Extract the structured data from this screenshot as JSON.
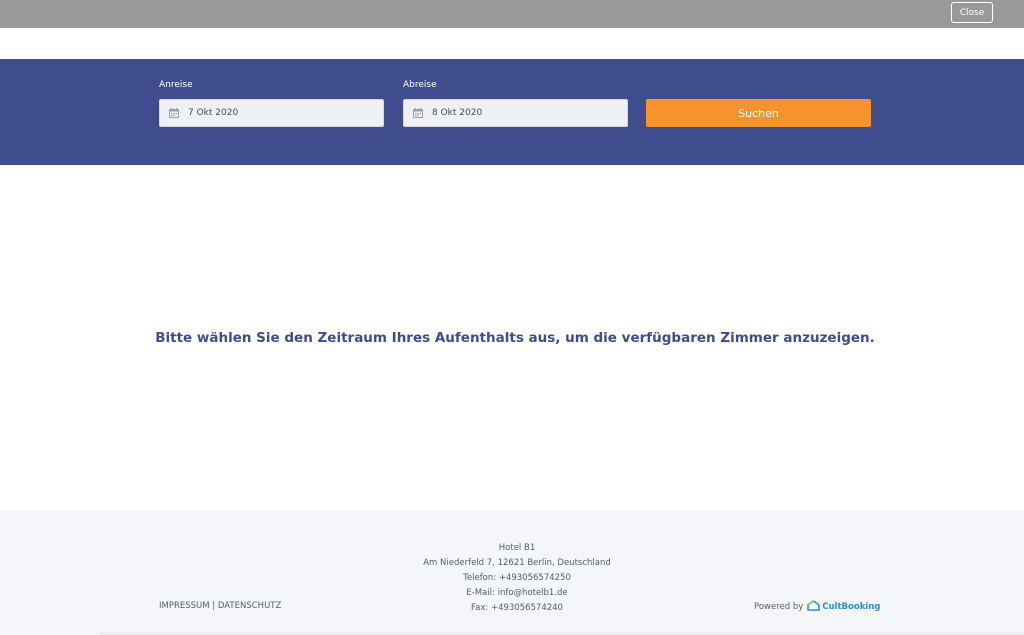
{
  "topbar": {
    "close_label": "Close"
  },
  "search": {
    "arrival_label": "Anreise",
    "arrival_value": "7 Okt 2020",
    "departure_label": "Abreise",
    "departure_value": "8 Okt 2020",
    "search_label": "Suchen",
    "calendar_icon": "calendar-icon"
  },
  "main": {
    "message": "Bitte wählen Sie den Zeitraum Ihres Aufenthalts aus, um die verfügbaren Zimmer anzuzeigen."
  },
  "footer": {
    "hotel_name": "Hotel B1",
    "address": "Am Niederfeld 7, 12621 Berlin, Deutschland",
    "phone": "Telefon: +493056574250",
    "email": "E-Mail: info@hotelb1.de",
    "fax": "Fax: +493056574240",
    "impressum": "IMPRESSUM",
    "separator": "|",
    "datenschutz": "DATENSCHUTZ",
    "powered_by": "Powered by",
    "brand": "CultBooking",
    "brand_icon": "cultbooking-logo-icon"
  },
  "colors": {
    "band": "#3f4d8f",
    "accent": "#f6932f",
    "topbar": "#97999b",
    "brand": "#2a8fd4"
  }
}
